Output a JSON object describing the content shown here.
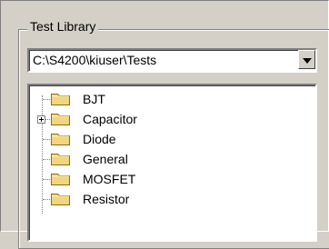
{
  "group": {
    "label": "Test Library"
  },
  "combo": {
    "value": "C:\\S4200\\kiuser\\Tests"
  },
  "tree": {
    "items": [
      {
        "label": "BJT",
        "icon": "folder-icon",
        "expandable": false
      },
      {
        "label": "Capacitor",
        "icon": "folder-icon",
        "expandable": true
      },
      {
        "label": "Diode",
        "icon": "folder-icon",
        "expandable": false
      },
      {
        "label": "General",
        "icon": "folder-icon",
        "expandable": false
      },
      {
        "label": "MOSFET",
        "icon": "folder-icon",
        "expandable": false
      },
      {
        "label": "Resistor",
        "icon": "folder-icon",
        "expandable": false
      }
    ]
  },
  "colors": {
    "background": "#d4d0c8",
    "folder": "#f3d57e",
    "folderEdge": "#8c6d19"
  }
}
